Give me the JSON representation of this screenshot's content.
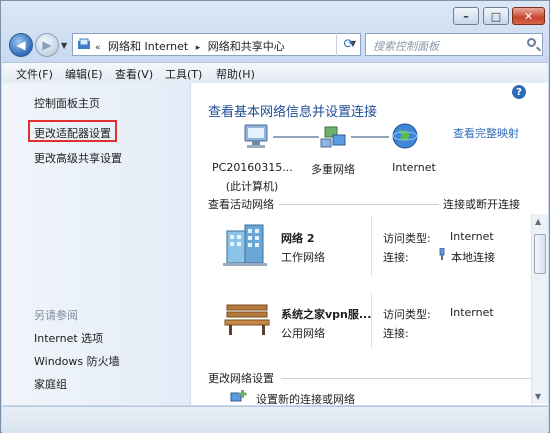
{
  "window": {
    "title_buttons": {
      "minimize": "–",
      "maximize": "□",
      "close": "✕"
    }
  },
  "nav": {
    "breadcrumb": [
      "«",
      "网络和 Internet",
      "▸",
      "网络和共享中心"
    ],
    "search_placeholder": "搜索控制面板"
  },
  "menu": {
    "items": [
      "文件(F)",
      "编辑(E)",
      "查看(V)",
      "工具(T)",
      "帮助(H)"
    ]
  },
  "sidebar": {
    "home": "控制面板主页",
    "adapter": "更改适配器设置",
    "advanced": "更改高级共享设置",
    "see_also": "另请参阅",
    "see_also_items": [
      "Internet 选项",
      "Windows 防火墙",
      "家庭组"
    ]
  },
  "main": {
    "headline": "查看基本网络信息并设置连接",
    "map_link": "查看完整映射",
    "nodes": [
      {
        "label": "PC20160315...",
        "sublabel": "(此计算机)",
        "icon": "computer-icon"
      },
      {
        "label": "多重网络",
        "icon": "network-icon"
      },
      {
        "label": "Internet",
        "icon": "globe-icon"
      }
    ],
    "active_title": "查看活动网络",
    "connect_link": "连接或断开连接",
    "networks": [
      {
        "name": "网络  2",
        "type": "工作网络",
        "icon": "building-icon",
        "access_label": "访问类型:",
        "access_value": "Internet",
        "conn_label": "连接:",
        "conn_value": "本地连接",
        "conn_icon": "connection-icon"
      },
      {
        "name": "系统之家vpn服...",
        "type": "公用网络",
        "icon": "bench-icon",
        "access_label": "访问类型:",
        "access_value": "Internet",
        "conn_label": "连接:",
        "conn_value": ""
      }
    ],
    "change_title": "更改网络设置",
    "setup_link": "设置新的连接或网络"
  },
  "help_icon": "?"
}
